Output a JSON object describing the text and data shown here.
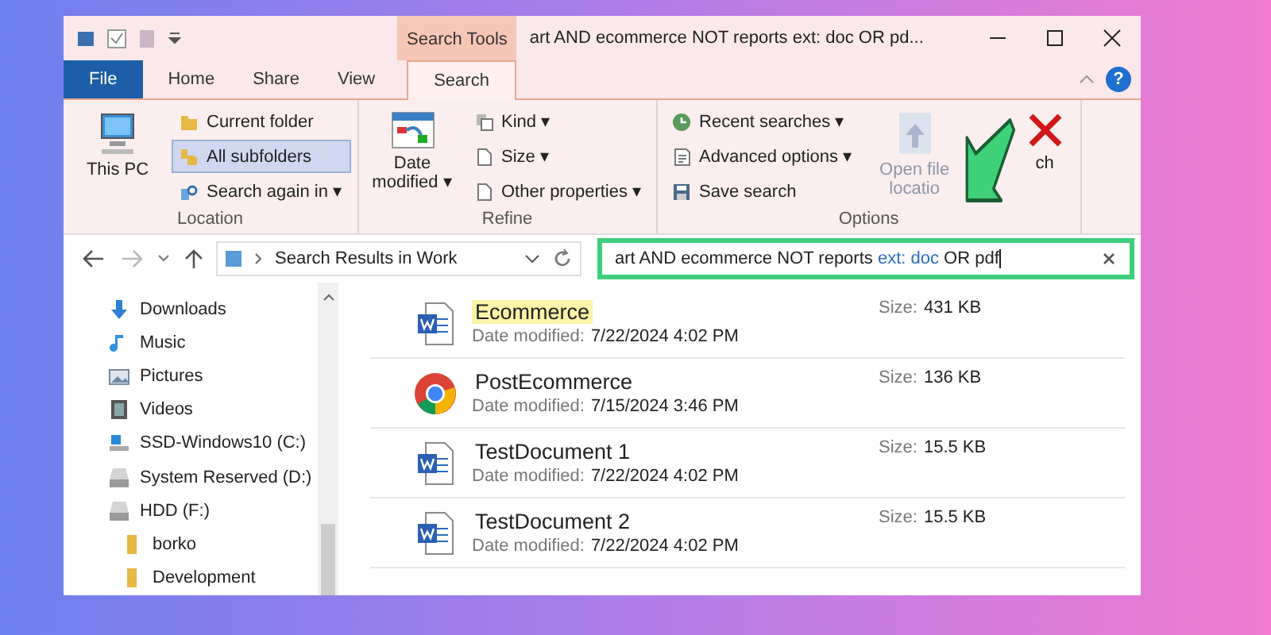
{
  "window": {
    "title": "art AND ecommerce NOT reports ext: doc OR pd...",
    "context_tab_header": "Search Tools",
    "help_button": "?"
  },
  "ribbon_tabs": [
    {
      "label": "File",
      "kind": "file",
      "selected": false
    },
    {
      "label": "Home",
      "kind": "tab",
      "selected": false
    },
    {
      "label": "Share",
      "kind": "tab",
      "selected": false
    },
    {
      "label": "View",
      "kind": "tab",
      "selected": false
    },
    {
      "label": "Search",
      "kind": "tab",
      "selected": true
    }
  ],
  "ribbon_groups": [
    {
      "label": "Location",
      "items": [
        {
          "kind": "large",
          "label": "This PC",
          "disabled": false,
          "selected": false
        },
        {
          "kind": "small",
          "label": "Current folder",
          "disabled": false,
          "selected": false
        },
        {
          "kind": "small",
          "label": "All subfolders",
          "disabled": false,
          "selected": true
        },
        {
          "kind": "small",
          "label": "Search again in ▾",
          "disabled": false,
          "selected": false
        }
      ]
    },
    {
      "label": "Refine",
      "items": [
        {
          "kind": "large",
          "label": "Date modified ▾",
          "disabled": false,
          "selected": false
        },
        {
          "kind": "small",
          "label": "Kind ▾",
          "disabled": false,
          "selected": false
        },
        {
          "kind": "small",
          "label": "Size ▾",
          "disabled": false,
          "selected": false
        },
        {
          "kind": "small",
          "label": "Other properties ▾",
          "disabled": false,
          "selected": false
        }
      ]
    },
    {
      "label": "Options",
      "items": [
        {
          "kind": "small",
          "label": "Recent searches ▾",
          "disabled": false,
          "selected": false
        },
        {
          "kind": "small",
          "label": "Advanced options ▾",
          "disabled": false,
          "selected": false
        },
        {
          "kind": "small",
          "label": "Save search",
          "disabled": false,
          "selected": false
        },
        {
          "kind": "large",
          "label": "Open file locatio",
          "disabled": true,
          "selected": false
        },
        {
          "kind": "large",
          "label": "ch",
          "disabled": false,
          "selected": false
        }
      ]
    }
  ],
  "address_bar": {
    "path": "Search Results in Work"
  },
  "search": {
    "value": [
      {
        "kind": "plain",
        "text": "art AND ecommerce NOT reports "
      },
      {
        "kind": "operator",
        "text": "ext: doc"
      },
      {
        "kind": "plain",
        "text": " OR pdf"
      }
    ]
  },
  "sidebar": {
    "items": [
      {
        "label": "Downloads"
      },
      {
        "label": "Music"
      },
      {
        "label": "Pictures"
      },
      {
        "label": "Videos"
      },
      {
        "label": "SSD-Windows10 (C:)"
      },
      {
        "label": "System Reserved (D:)"
      },
      {
        "label": "HDD (F:)",
        "children": [
          {
            "label": "borko"
          },
          {
            "label": "Development"
          }
        ]
      }
    ]
  },
  "files": [
    {
      "name": "Ecommerce",
      "kind": "word",
      "highlighted": true,
      "date_label": "Date modified:",
      "date": "7/22/2024 4:02 PM",
      "size_label": "Size:",
      "size": "431 KB"
    },
    {
      "name": "PostEcommerce",
      "kind": "chrome",
      "highlighted": false,
      "date_label": "Date modified:",
      "date": "7/15/2024 3:46 PM",
      "size_label": "Size:",
      "size": "136 KB"
    },
    {
      "name": "TestDocument 1",
      "kind": "word",
      "highlighted": false,
      "date_label": "Date modified:",
      "date": "7/22/2024 4:02 PM",
      "size_label": "Size:",
      "size": "15.5 KB"
    },
    {
      "name": "TestDocument 2",
      "kind": "word",
      "highlighted": false,
      "date_label": "Date modified:",
      "date": "7/22/2024 4:02 PM",
      "size_label": "Size:",
      "size": "15.5 KB"
    }
  ]
}
